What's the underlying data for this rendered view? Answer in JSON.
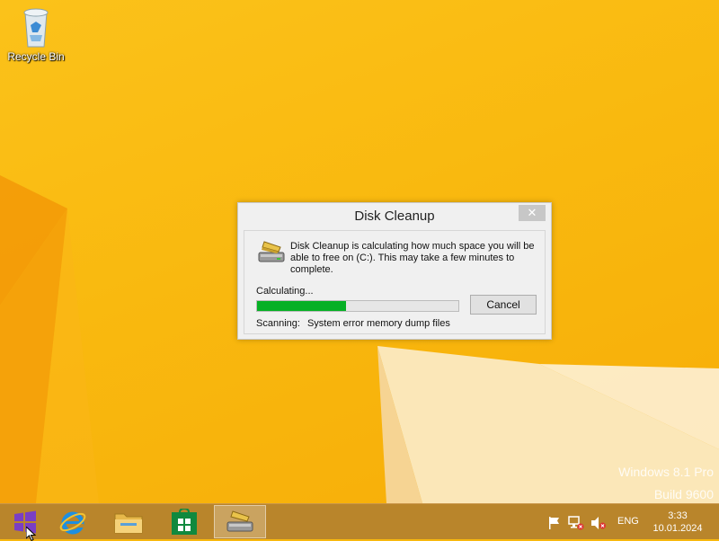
{
  "desktop": {
    "icons": [
      {
        "label": "Recycle Bin",
        "icon": "recycle-bin-icon"
      }
    ],
    "watermark": {
      "line1": "Windows 8.1 Pro",
      "line2": "Build 9600"
    }
  },
  "dialog": {
    "title": "Disk Cleanup",
    "close_label": "✕",
    "message": "Disk Cleanup is calculating how much space you will be able to free on  (C:). This may take a few minutes to complete.",
    "status_label": "Calculating...",
    "progress_percent": 44,
    "cancel_label": "Cancel",
    "scanning_label": "Scanning:",
    "scanning_item": "System error memory dump files"
  },
  "taskbar": {
    "buttons": [
      {
        "icon": "windows-start-icon"
      },
      {
        "icon": "internet-explorer-icon"
      },
      {
        "icon": "file-explorer-icon"
      },
      {
        "icon": "windows-store-icon"
      },
      {
        "icon": "disk-cleanup-icon",
        "active": true
      }
    ],
    "tray": {
      "language": "ENG",
      "time": "3:33",
      "date": "10.01.2024"
    }
  },
  "colors": {
    "desktop_bg": "#f9b90f",
    "taskbar_bg": "#b9852b",
    "progress_fill": "#06b025"
  }
}
